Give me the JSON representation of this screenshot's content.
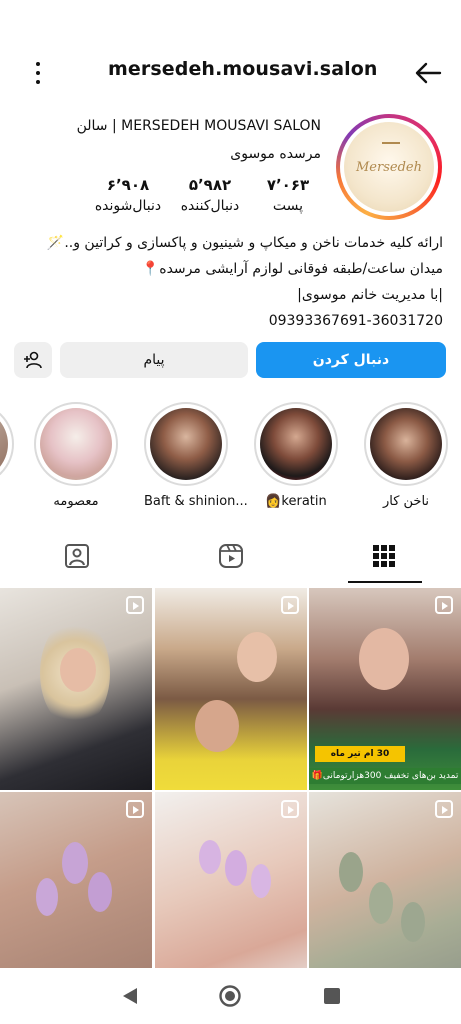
{
  "header": {
    "username": "mersedeh.mousavi.salon"
  },
  "profile": {
    "display_name": "MERSEDEH MOUSAVI SALON | سالن",
    "display_name_line2": "مرسده موسوی",
    "avatar_text": "Mersedeh",
    "stats": [
      {
        "value": "۷٬۰۶۳",
        "label": "پست"
      },
      {
        "value": "۵٬۹۸۲",
        "label": "دنبال‌کننده"
      },
      {
        "value": "۶٬۹۰۸",
        "label": "دنبال‌شونده"
      }
    ],
    "bio": [
      "ارائه کلیه خدمات ناخن و میکاپ و شینیون و پاکسازی و کراتین و..🪄",
      "میدان ساعت/طبقه فوقانی لوازم آرایشی مرسده📍",
      "|با مدیریت خانم موسوی|",
      "09393367691-36031720"
    ]
  },
  "buttons": {
    "follow": "دنبال کردن",
    "message": "پیام"
  },
  "highlights": [
    {
      "label": "ناخن کار"
    },
    {
      "label": "👩keratin"
    },
    {
      "label": "Baft & shinion..."
    },
    {
      "label": "معصومه"
    }
  ],
  "grid": {
    "promo_banner": "تمدید بن‌های تخفیف 300هزارتومانی🎁",
    "promo_tag": "30 ام تیر ماه"
  },
  "colors": {
    "follow_button": "#1a95f1",
    "secondary_button": "#efefef"
  }
}
